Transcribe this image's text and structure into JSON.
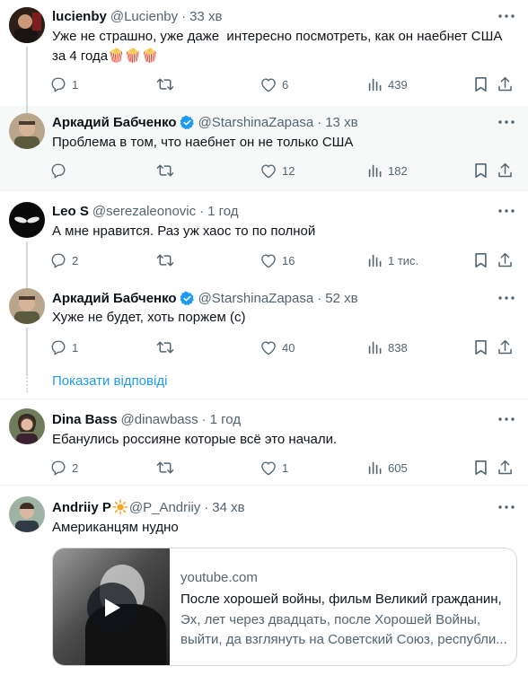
{
  "tweets": [
    {
      "name": "lucienby",
      "handle": "@Lucienby",
      "time": "33 хв",
      "text": "Уже не страшно, уже даже  интересно посмотреть, как он наебнет США за 4 года🍿🍿🍿",
      "replies": "1",
      "retweets": "",
      "likes": "6",
      "views": "439",
      "avatar": "avatar-lucienby"
    },
    {
      "name": "Аркадий Бабченко",
      "handle": "@StarshinaZapasa",
      "time": "13 хв",
      "text": "Проблема в том, что наебнет он не только США",
      "replies": "",
      "retweets": "",
      "likes": "12",
      "views": "182",
      "verified": true,
      "avatar": "avatar-babchenko"
    },
    {
      "name": "Leo S",
      "handle": "@serezaleonovic",
      "time": "1 год",
      "text": "А мне нравится. Раз уж хаос то по полной",
      "replies": "2",
      "retweets": "",
      "likes": "16",
      "views": "1 тис.",
      "avatar": "avatar-leo"
    },
    {
      "name": "Аркадий Бабченко",
      "handle": "@StarshinaZapasa",
      "time": "52 хв",
      "text": "Хуже не будет, хоть поржем (с)",
      "replies": "1",
      "retweets": "",
      "likes": "40",
      "views": "838",
      "verified": true,
      "avatar": "avatar-babchenko"
    },
    {
      "name": "Dina Bass",
      "handle": "@dinawbass",
      "time": "1 год",
      "text": "Ебанулись россияне которые всё это начали.",
      "replies": "2",
      "retweets": "",
      "likes": "1",
      "views": "605",
      "avatar": "avatar-dina"
    },
    {
      "name": "Andriiy P",
      "handle": "@P_Andriiy",
      "time": "34 хв",
      "text": "Американцям нудно",
      "avatar": "avatar-andriiy"
    }
  ],
  "show_replies": "Показати відповіді",
  "card": {
    "domain": "youtube.com",
    "title": "После хорошей войны, фильм Великий гражданин,",
    "desc_line1": "Эх, лет через двадцать, после Хорошей Войны,",
    "desc_line2": "выйти, да взглянуть на Советский Союз, республи..."
  },
  "colors": {
    "accent": "#1d9bf0",
    "muted": "#536471",
    "highlight_bg": "#f7f9f9"
  },
  "icons": [
    "reply-icon",
    "retweet-icon",
    "like-icon",
    "views-icon",
    "bookmark-icon",
    "share-icon",
    "more-icon",
    "verified-icon",
    "sun-icon",
    "play-icon"
  ]
}
